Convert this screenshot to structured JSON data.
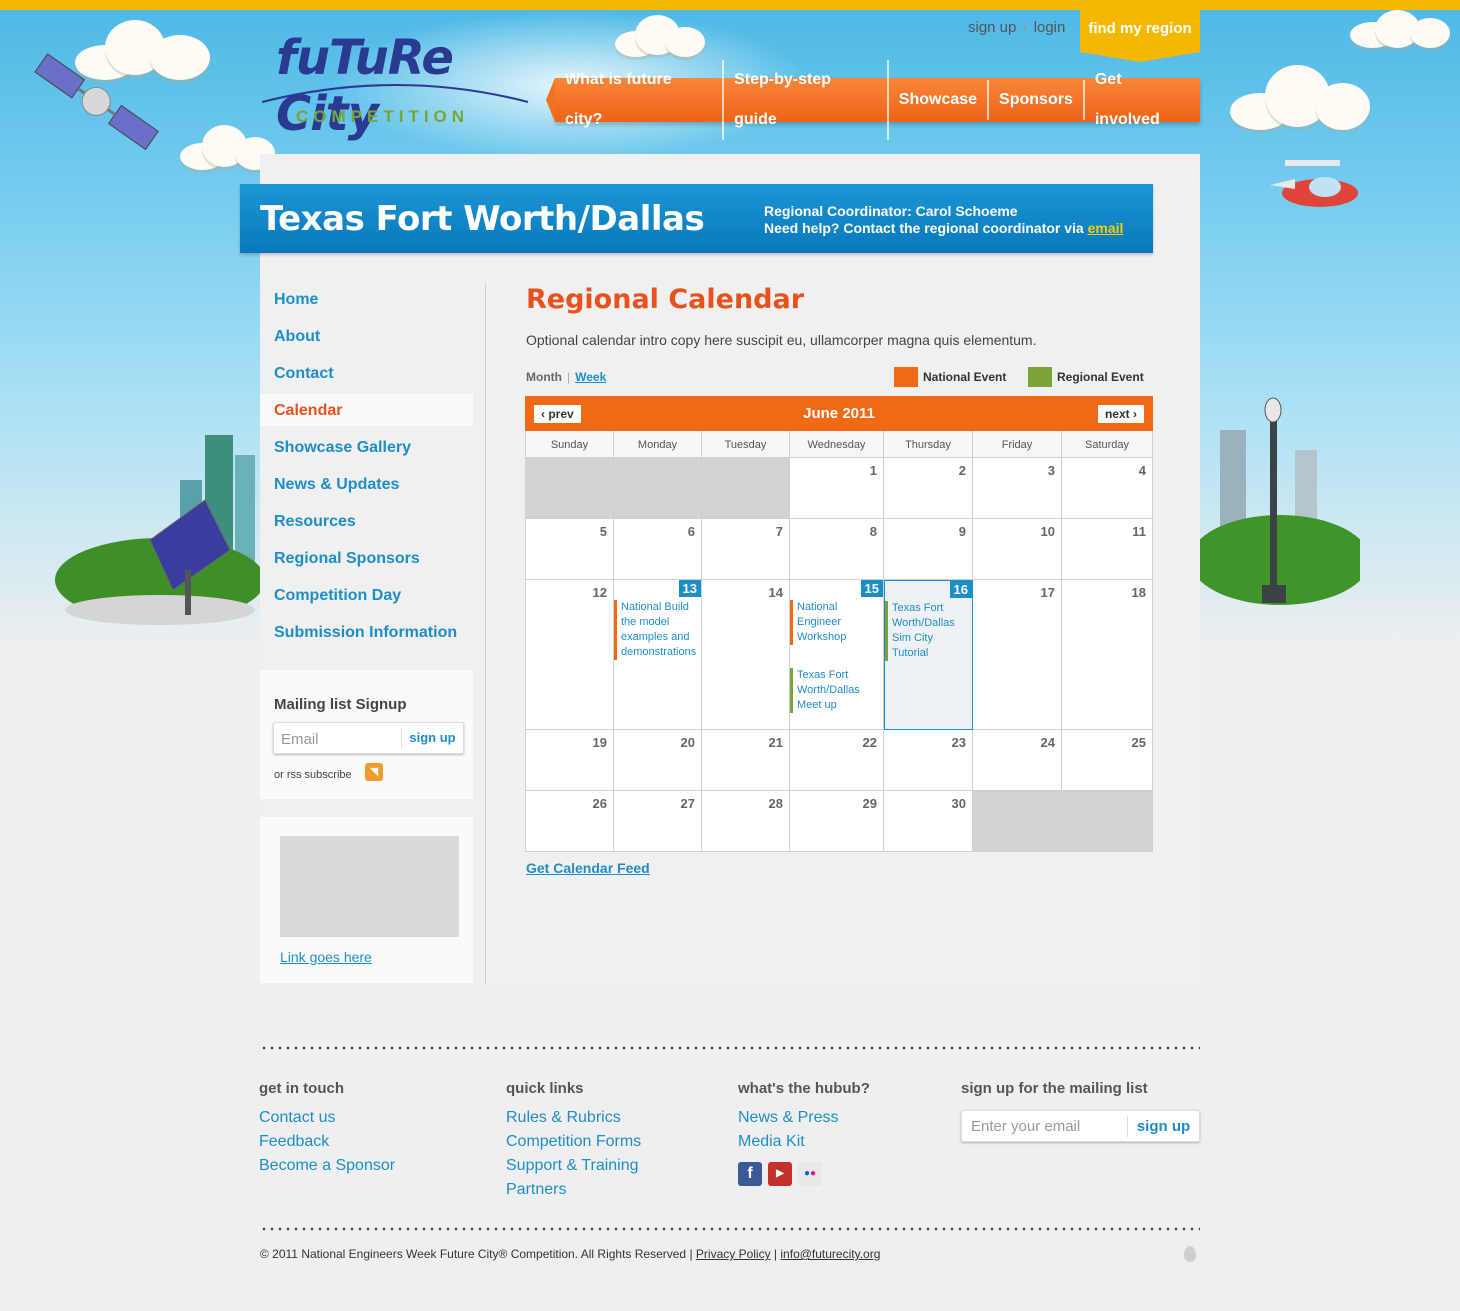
{
  "brand": {
    "logo_word": "fuTuRe City",
    "logo_sub": "COMPETITION",
    "accent_orange": "#f06a16",
    "accent_blue": "#1d8dc8",
    "accent_green": "#7aa536",
    "accent_yellow": "#f5b800"
  },
  "header": {
    "signup": "sign up",
    "login": "login",
    "find_region": "find my region",
    "nav": [
      "What is future city?",
      "Step-by-step guide",
      "Showcase",
      "Sponsors",
      "Get involved"
    ]
  },
  "region": {
    "title": "Texas Fort Worth/Dallas",
    "coordinator": "Regional Coordinator: Carol Schoeme",
    "help_prefix": "Need help? Contact the regional coordinator via",
    "help_link": "email"
  },
  "sidebar": {
    "items": [
      {
        "label": "Home"
      },
      {
        "label": "About"
      },
      {
        "label": "Contact"
      },
      {
        "label": "Calendar"
      },
      {
        "label": "Showcase Gallery"
      },
      {
        "label": "News & Updates"
      },
      {
        "label": "Resources"
      },
      {
        "label": "Regional Sponsors"
      },
      {
        "label": "Competition Day"
      },
      {
        "label": "Submission Information"
      }
    ],
    "active": "Calendar",
    "mailing": {
      "title": "Mailing list Signup",
      "placeholder": "Email",
      "button": "sign up",
      "rss": "or rss subscribe"
    },
    "ad_link": "Link goes here"
  },
  "main": {
    "title_bold": "Regional",
    "title_rest": "Calendar",
    "intro": "Optional calendar intro copy here suscipit eu, ullamcorper magna quis elementum.",
    "view_month": "Month",
    "view_week": "Week",
    "legend_national": "National Event",
    "legend_regional": "Regional Event",
    "feed": "Get Calendar Feed"
  },
  "calendar": {
    "month": "June 2011",
    "prev": "prev",
    "next": "next",
    "weekdays": [
      "Sunday",
      "Monday",
      "Tuesday",
      "Wednesday",
      "Thursday",
      "Friday",
      "Saturday"
    ],
    "weeks": [
      [
        "",
        "",
        "",
        "1",
        "2",
        "3",
        "4"
      ],
      [
        "5",
        "6",
        "7",
        "8",
        "9",
        "10",
        "11"
      ],
      [
        "12",
        "13",
        "14",
        "15",
        "16",
        "17",
        "18"
      ],
      [
        "19",
        "20",
        "21",
        "22",
        "23",
        "24",
        "25"
      ],
      [
        "26",
        "27",
        "28",
        "29",
        "30",
        "",
        ""
      ]
    ],
    "events": [
      {
        "day": "13",
        "type": "national",
        "text": "National Build the model examples and demonstrations"
      },
      {
        "day": "15",
        "type": "national",
        "text": "National Engineer Workshop"
      },
      {
        "day": "15",
        "type": "regional",
        "text": "Texas Fort Worth/Dallas Meet up"
      },
      {
        "day": "16",
        "type": "regional",
        "text": "Texas Fort Worth/Dallas Sim City Tutorial"
      }
    ],
    "highlighted_days": [
      "13",
      "15",
      "16"
    ],
    "selected_day": "16"
  },
  "footer": {
    "col1": {
      "title": "get in touch",
      "links": [
        "Contact us",
        "Feedback",
        "Become a Sponsor"
      ]
    },
    "col2": {
      "title": "quick links",
      "links": [
        "Rules & Rubrics",
        "Competition Forms",
        "Support & Training",
        "Partners"
      ]
    },
    "col3": {
      "title": "what's the hubub?",
      "links": [
        "News & Press",
        "Media Kit"
      ],
      "social": [
        "facebook-icon",
        "youtube-icon",
        "flickr-icon"
      ]
    },
    "col4": {
      "title": "sign up for the mailing list",
      "placeholder": "Enter your email",
      "button": "sign up"
    },
    "copyright": "© 2011 National Engineers Week Future City® Competition. All Rights Reserved |",
    "privacy": "Privacy Policy",
    "email": "info@futurecity.org"
  }
}
